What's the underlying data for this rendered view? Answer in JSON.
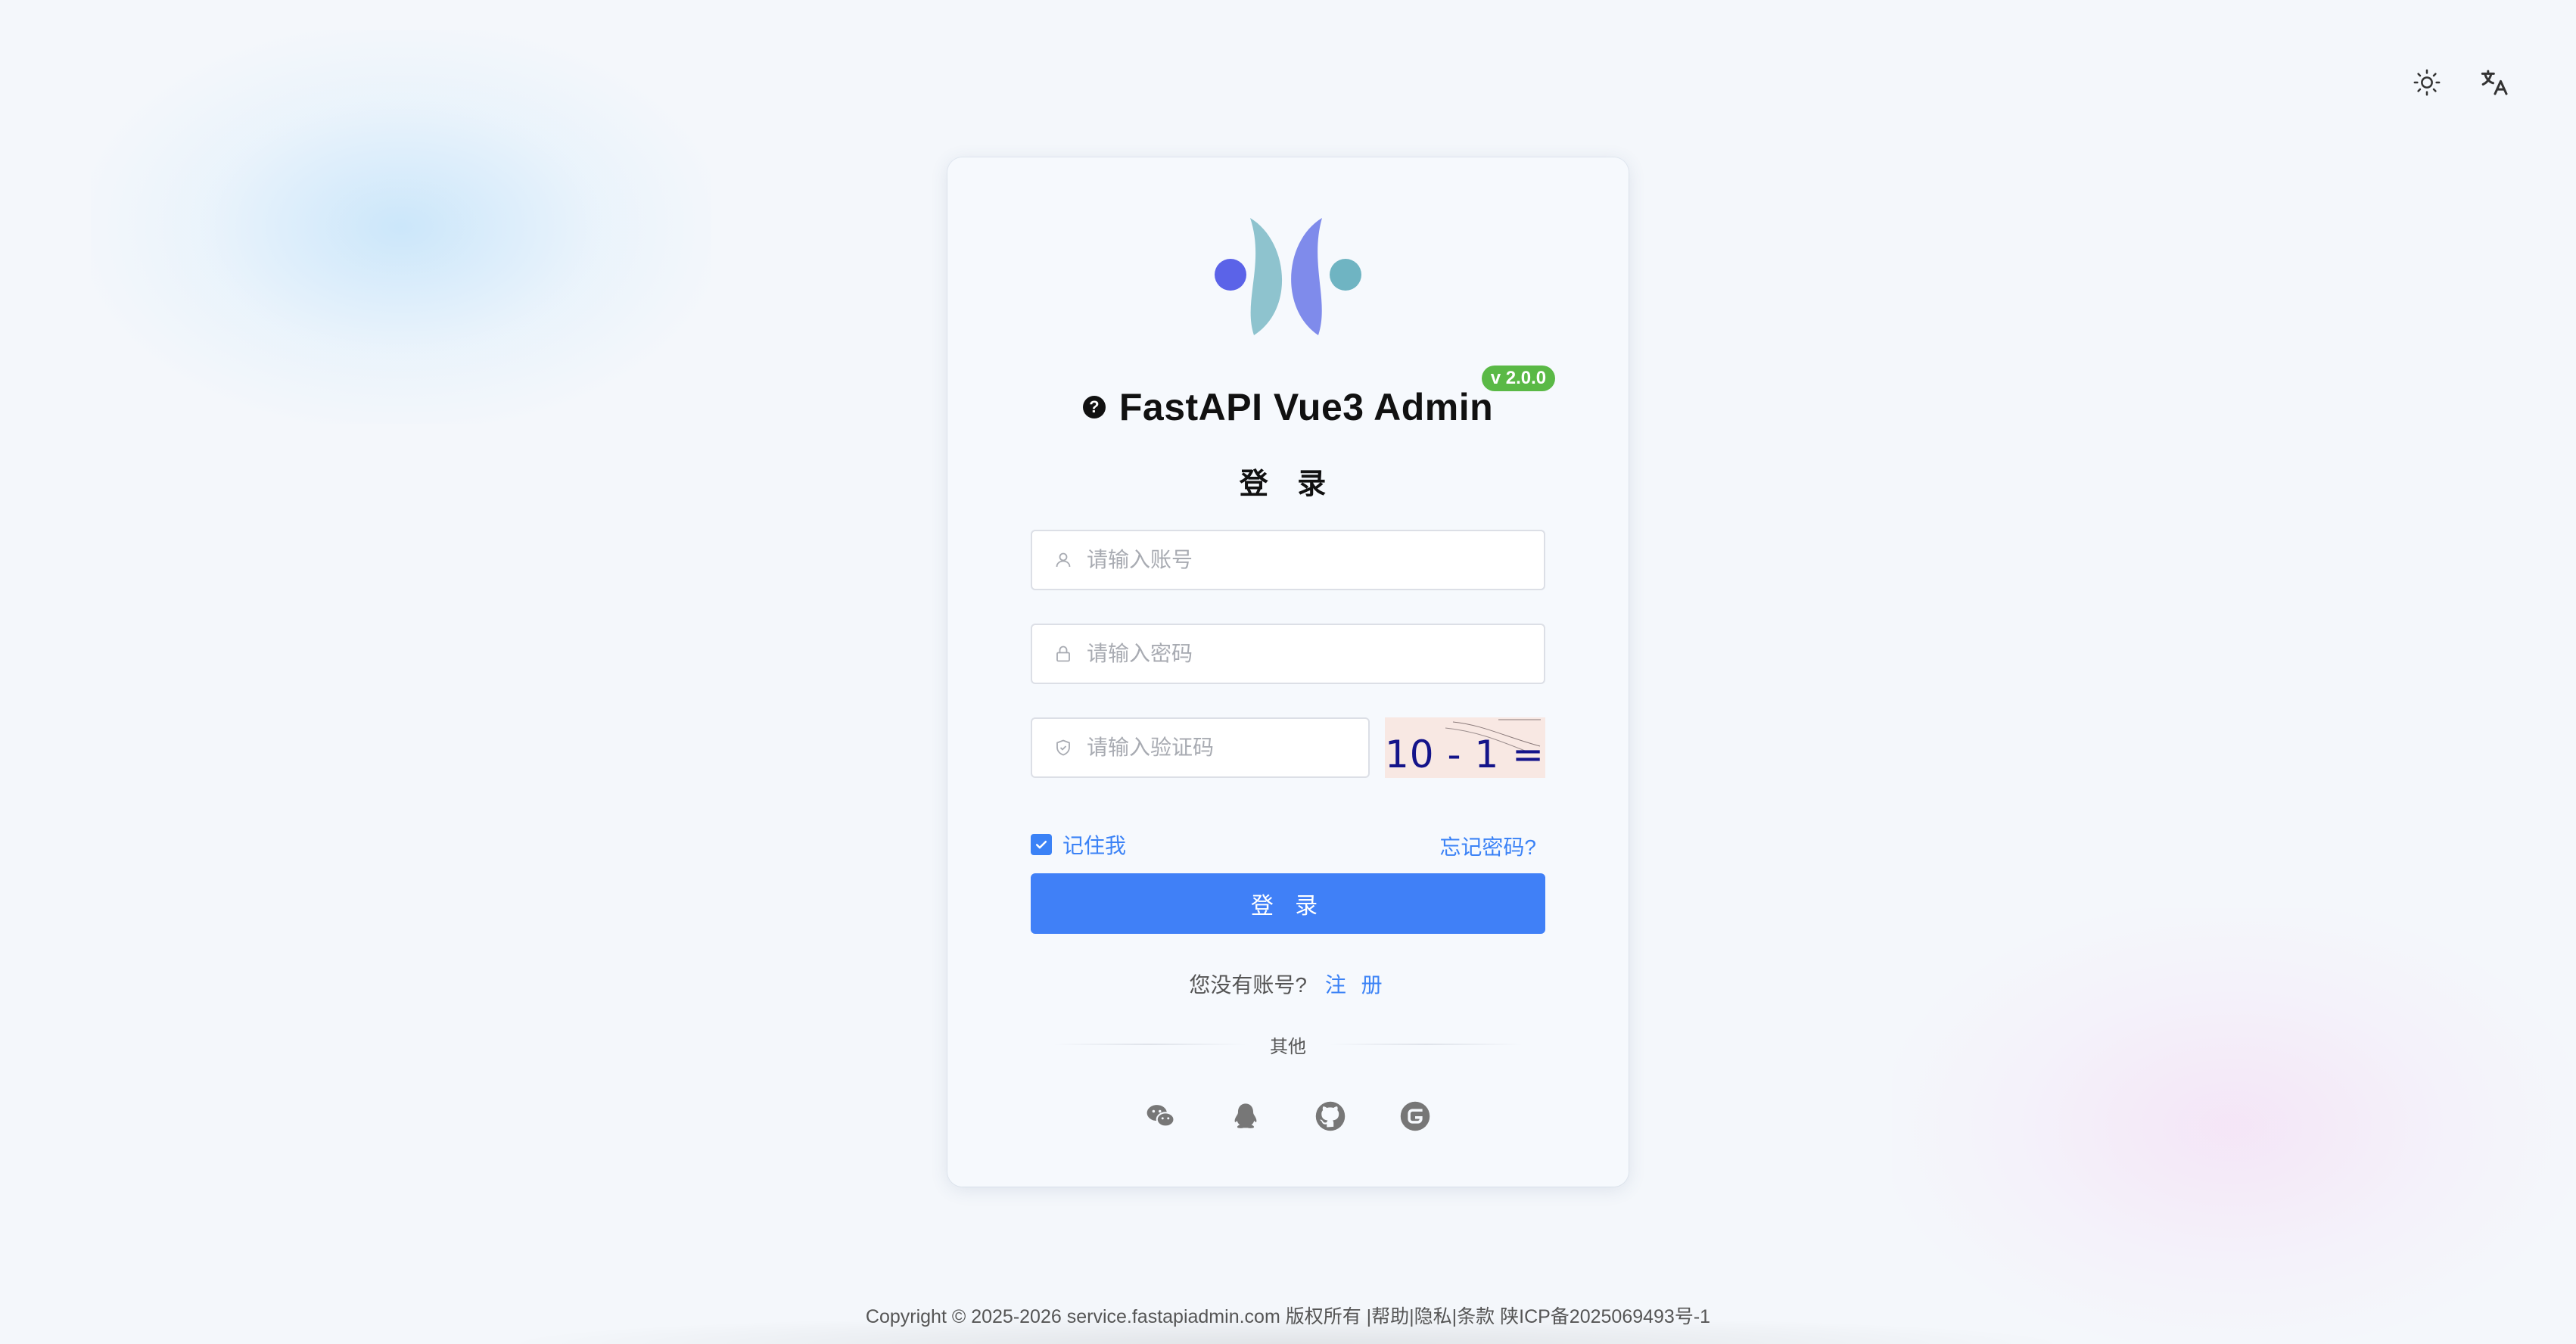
{
  "app": {
    "title": "FastAPI Vue3 Admin",
    "version": "v 2.0.0",
    "help_glyph": "?"
  },
  "login": {
    "heading": "登 录",
    "username_placeholder": "请输入账号",
    "password_placeholder": "请输入密码",
    "captcha_placeholder": "请输入验证码",
    "captcha_text": "10 - 1 = ?",
    "remember_label": "记住我",
    "remember_checked": true,
    "forgot_label": "忘记密码?",
    "submit_label": "登 录",
    "no_account_text": "您没有账号?",
    "register_label": "注 册",
    "other_label": "其他"
  },
  "socials": [
    {
      "icon": "wechat-icon"
    },
    {
      "icon": "qq-icon"
    },
    {
      "icon": "github-icon"
    },
    {
      "icon": "gitee-icon"
    }
  ],
  "header_actions": [
    {
      "icon": "sun-icon"
    },
    {
      "icon": "translate-icon"
    }
  ],
  "footer": {
    "copyright": "Copyright © 2025-2026 service.fastapiadmin.com 版权所有",
    "help": "|帮助",
    "privacy": "|隐私",
    "terms": "|条款",
    "icp": "陕ICP备2025069493号-1"
  },
  "colors": {
    "primary": "#4080f7",
    "badge": "#5ab946",
    "link": "#3b82f6"
  }
}
